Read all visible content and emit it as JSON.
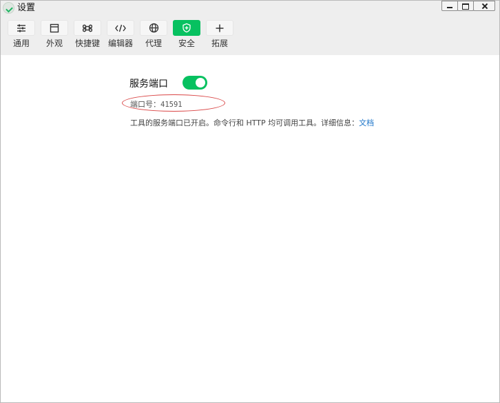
{
  "window": {
    "title": "设置"
  },
  "toolbar": {
    "items": [
      {
        "label": "通用",
        "icon": "sliders-icon",
        "active": false
      },
      {
        "label": "外观",
        "icon": "window-layout-icon",
        "active": false
      },
      {
        "label": "快捷键",
        "icon": "command-key-icon",
        "active": false
      },
      {
        "label": "编辑器",
        "icon": "code-icon",
        "active": false
      },
      {
        "label": "代理",
        "icon": "globe-icon",
        "active": false
      },
      {
        "label": "安全",
        "icon": "shield-icon",
        "active": true
      },
      {
        "label": "拓展",
        "icon": "plus-icon",
        "active": false
      }
    ]
  },
  "security": {
    "service_port_label": "服务端口",
    "service_port_enabled": true,
    "port_label": "端口号：",
    "port_value": "41591",
    "description": "工具的服务端口已开启。命令行和 HTTP 均可调用工具。详细信息：",
    "doc_link_label": "文档"
  },
  "colors": {
    "accent": "#07c160",
    "link": "#1a73c8",
    "annotation": "#d94444"
  }
}
